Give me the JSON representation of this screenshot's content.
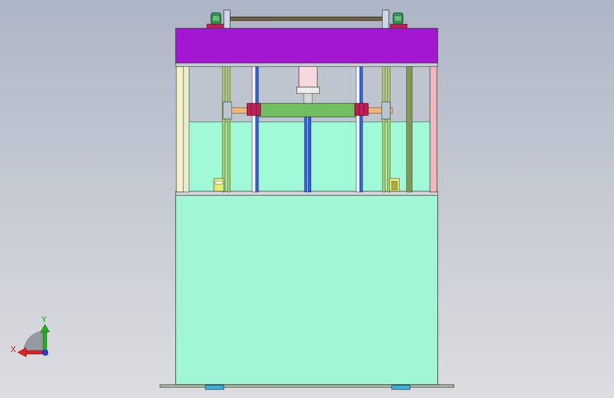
{
  "viewport": {
    "background_top": "#adb6c7",
    "background_bottom": "#dcdde0"
  },
  "model": {
    "colors": {
      "top_plate": "#a515d4",
      "lower_body": "#9ff7d5",
      "tank_fill": "#a0fad7",
      "crossbar": "#70c060",
      "clamp_block": "#c0205a",
      "shaft_blue": "#3060e0",
      "copper_rod": "#f0b478",
      "motor_green": "#2e9a4a",
      "guide_green": "#a8d060",
      "post_cream": "#f3f2c4",
      "post_pink": "#f2b8be"
    }
  },
  "triad": {
    "x_label": "X",
    "y_label": "Y",
    "x_color": "#e02020",
    "y_color": "#20b020",
    "z_color": "#2040e0"
  }
}
